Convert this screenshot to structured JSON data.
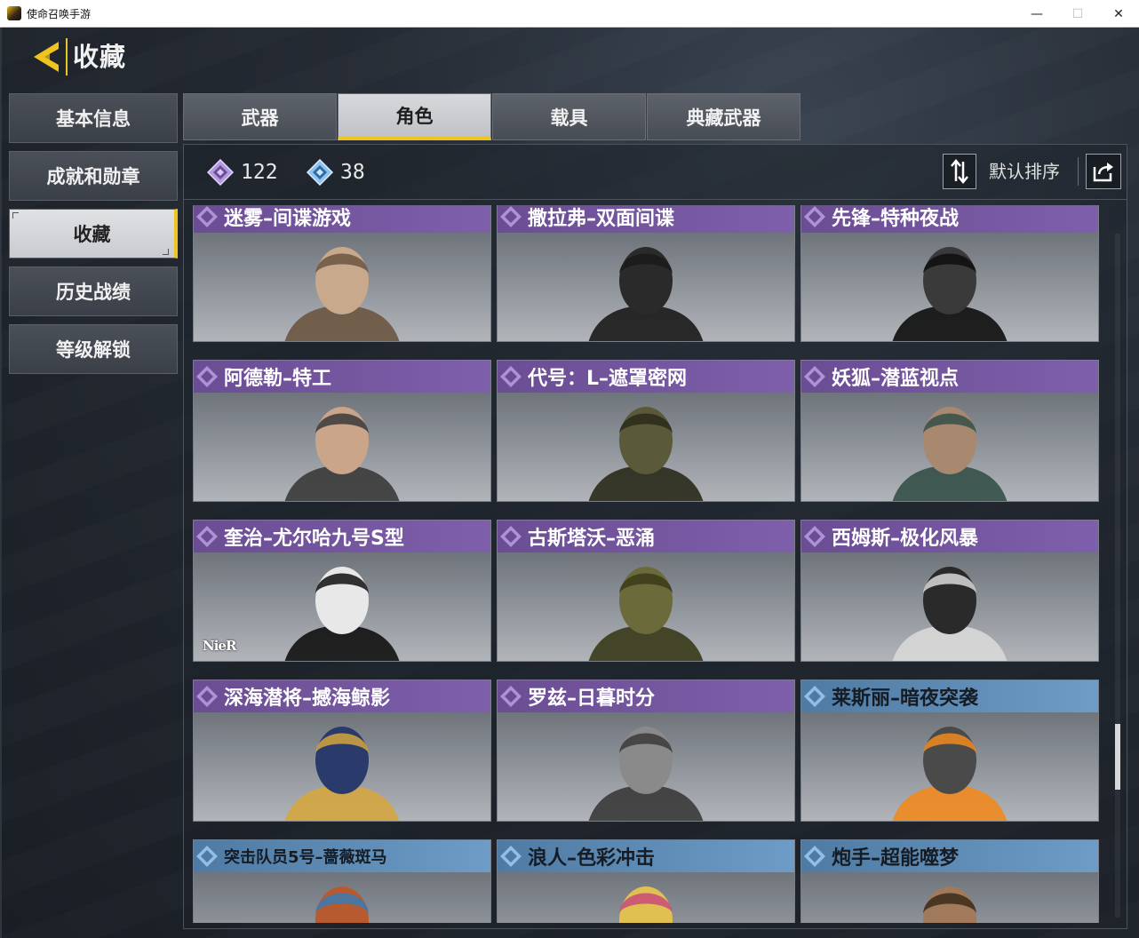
{
  "window": {
    "title": "使命召唤手游",
    "min_glyph": "—",
    "max_glyph": "☐",
    "close_glyph": "✕"
  },
  "header": {
    "title": "收藏",
    "back_icon": "back-arrow-icon"
  },
  "sidebar": {
    "items": [
      {
        "label": "基本信息",
        "active": false
      },
      {
        "label": "成就和勋章",
        "active": false
      },
      {
        "label": "收藏",
        "active": true
      },
      {
        "label": "历史战绩",
        "active": false
      },
      {
        "label": "等级解锁",
        "active": false
      }
    ]
  },
  "tabs": [
    {
      "label": "武器",
      "active": false
    },
    {
      "label": "角色",
      "active": true
    },
    {
      "label": "载具",
      "active": false
    },
    {
      "label": "典藏武器",
      "active": false
    }
  ],
  "counters": {
    "purple_count": "122",
    "blue_count": "38"
  },
  "sort": {
    "label": "默认排序",
    "sort_icon": "sort-toggle-icon",
    "share_icon": "share-export-icon"
  },
  "characters": [
    {
      "name": "迷雾–间谍游戏",
      "rarity": "purple"
    },
    {
      "name": "撒拉弗–双面间谍",
      "rarity": "purple"
    },
    {
      "name": "先锋–特种夜战",
      "rarity": "purple"
    },
    {
      "name": "阿德勒–特工",
      "rarity": "purple"
    },
    {
      "name": "代号：L–遮罩密网",
      "rarity": "purple"
    },
    {
      "name": "妖狐–潜蓝视点",
      "rarity": "purple"
    },
    {
      "name": "奎治–尤尔哈九号S型",
      "rarity": "purple",
      "badge": "NieR"
    },
    {
      "name": "古斯塔沃–恶涌",
      "rarity": "purple"
    },
    {
      "name": "西姆斯–极化风暴",
      "rarity": "purple"
    },
    {
      "name": "深海潜将–撼海鲸影",
      "rarity": "purple"
    },
    {
      "name": "罗兹–日暮时分",
      "rarity": "purple"
    },
    {
      "name": "莱斯丽–暗夜突袭",
      "rarity": "blue"
    },
    {
      "name": "突击队员5号–蔷薇斑马",
      "rarity": "blue"
    },
    {
      "name": "浪人–色彩冲击",
      "rarity": "blue"
    },
    {
      "name": "炮手–超能噬梦",
      "rarity": "blue"
    }
  ],
  "colors": {
    "accent": "#f0c31e",
    "purple_rarity": "#7e5fab",
    "blue_rarity": "#6e9cc6"
  }
}
